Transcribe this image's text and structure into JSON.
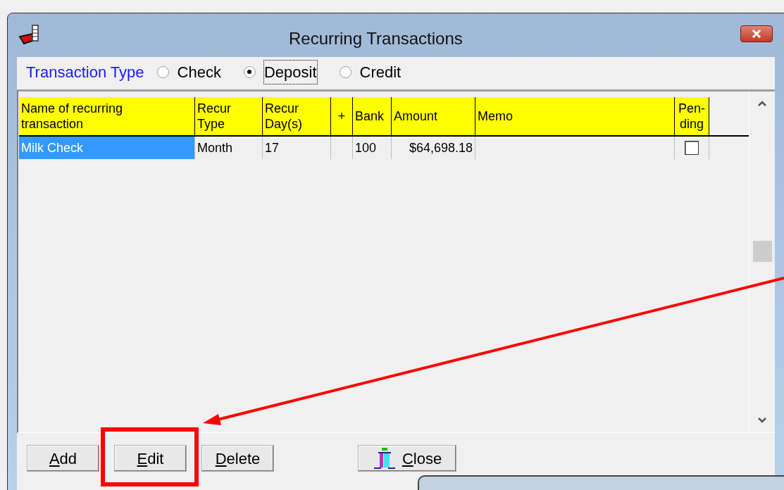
{
  "window": {
    "title": "Recurring Transactions"
  },
  "transaction_type": {
    "label": "Transaction Type",
    "options": [
      {
        "label": "Check",
        "selected": false,
        "focused": false
      },
      {
        "label": "Deposit",
        "selected": true,
        "focused": true
      },
      {
        "label": "Credit",
        "selected": false,
        "focused": false
      }
    ]
  },
  "table": {
    "columns": [
      {
        "label": "Name of recurring transaction"
      },
      {
        "label": "Recur Type"
      },
      {
        "label": "Recur Day(s)"
      },
      {
        "label": "+"
      },
      {
        "label": "Bank"
      },
      {
        "label": "Amount"
      },
      {
        "label": "Memo"
      },
      {
        "label": "Pen-ding"
      }
    ],
    "rows": [
      {
        "selected": true,
        "cells": [
          "Milk Check",
          "Month",
          "17",
          "",
          "100",
          "$64,698.18",
          ""
        ],
        "pending": false
      }
    ]
  },
  "buttons": [
    {
      "label": "Add",
      "kind": "text"
    },
    {
      "label": "Edit",
      "kind": "text"
    },
    {
      "label": "Delete",
      "kind": "text"
    },
    {
      "label": "Close",
      "kind": "icon"
    }
  ]
}
